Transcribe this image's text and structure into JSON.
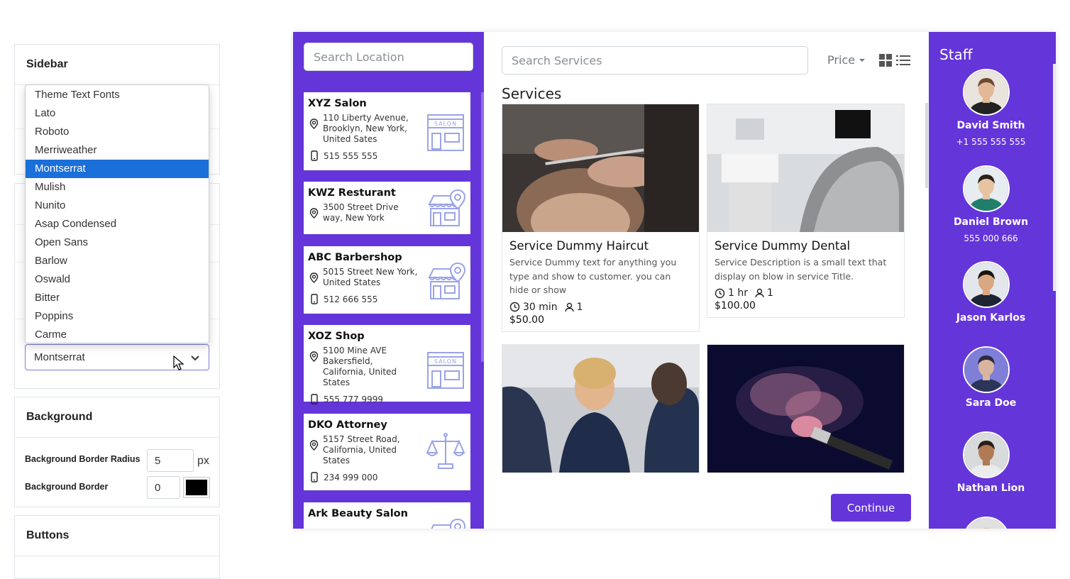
{
  "settings": {
    "sidebar_title": "Sidebar",
    "background_title": "Background",
    "buttons_title": "Buttons",
    "font_options": [
      "Theme Text Fonts",
      "Lato",
      "Roboto",
      "Merriweather",
      "Montserrat",
      "Mulish",
      "Nunito",
      "Asap Condensed",
      "Open Sans",
      "Barlow",
      "Oswald",
      "Bitter",
      "Poppins",
      "Carme"
    ],
    "selected_font": "Montserrat",
    "bg_radius_label": "Background Border Radius",
    "bg_radius_value": "5",
    "bg_radius_unit": "px",
    "bg_border_label": "Background Border",
    "bg_border_value": "0",
    "bg_border_color": "#000000"
  },
  "widget": {
    "accent_color": "#6435d9",
    "location_search_placeholder": "Search Location",
    "locations": [
      {
        "name": "XYZ Salon",
        "address": "110 Liberty Avenue, Brooklyn, New York, United Sates",
        "phone": "515 555 555",
        "icon": "salon-storefront-icon"
      },
      {
        "name": "KWZ Resturant",
        "address": "3500 Street Drive way, New York",
        "phone": "",
        "icon": "store-location-icon"
      },
      {
        "name": "ABC Barbershop",
        "address": "5015 Street New York, United States",
        "phone": "512 666 555",
        "icon": "store-location-icon"
      },
      {
        "name": "XOZ Shop",
        "address": "5100 Mine AVE Bakersfield, California, United States",
        "phone": "555 777 9999",
        "icon": "salon-storefront-icon"
      },
      {
        "name": "DKO Attorney",
        "address": "5157 Street Road, California, United States",
        "phone": "234 999 000",
        "icon": "scales-icon"
      },
      {
        "name": "Ark Beauty Salon",
        "address": "",
        "phone": "",
        "icon": "store-location-icon"
      }
    ],
    "service_search_placeholder": "Search Services",
    "price_label": "Price",
    "services_heading": "Services",
    "services": [
      {
        "name": "Service Dummy Haircut",
        "description": "Service Dummy text for anything you type and show to customer. you can hide or show",
        "duration": "30 min",
        "capacity": "1",
        "price": "$50.00"
      },
      {
        "name": "Service Dummy Dental",
        "description": "Service Description is a small text that display on blow in service Title.",
        "duration": "1 hr",
        "capacity": "1",
        "price": "$100.00"
      },
      {
        "name": "",
        "description": "",
        "duration": "",
        "capacity": "",
        "price": ""
      },
      {
        "name": "",
        "description": "",
        "duration": "",
        "capacity": "",
        "price": ""
      }
    ],
    "continue_label": "Continue",
    "staff_heading": "Staff",
    "staff": [
      {
        "name": "David Smith",
        "phone": "+1 555 555 555"
      },
      {
        "name": "Daniel Brown",
        "phone": "555 000 666"
      },
      {
        "name": "Jason Karlos",
        "phone": ""
      },
      {
        "name": "Sara Doe",
        "phone": ""
      },
      {
        "name": "Nathan Lion",
        "phone": ""
      }
    ]
  }
}
